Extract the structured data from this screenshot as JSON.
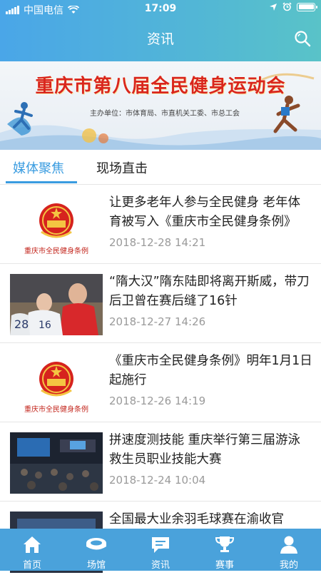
{
  "status_bar": {
    "carrier": "中国电信",
    "time": "17:09"
  },
  "header": {
    "title": "资讯"
  },
  "banner": {
    "title": "重庆市第八届全民健身运动会",
    "subtitle": "主办单位：市体育局、市直机关工委、市总工会"
  },
  "tabs": [
    {
      "label": "媒体聚焦",
      "active": true
    },
    {
      "label": "现场直击",
      "active": false
    }
  ],
  "news": [
    {
      "title": "让更多老年人参与全民健身 老年体育被写入《重庆市全民健身条例》",
      "time": "2018-12-28 14:21",
      "thumb_caption": "重庆市全民健身条例",
      "thumb": "national-emblem"
    },
    {
      "title": "“隋大汉”隋东陆即将离开斯威，带刀后卫曾在赛后缝了16针",
      "time": "2018-12-27 14:26",
      "thumb_caption": "",
      "thumb": "football-photo"
    },
    {
      "title": "《重庆市全民健身条例》明年1月1日起施行",
      "time": "2018-12-26 14:19",
      "thumb_caption": "重庆市全民健身条例",
      "thumb": "national-emblem"
    },
    {
      "title": "拼速度测技能 重庆举行第三届游泳救生员职业技能大赛",
      "time": "2018-12-24 10:04",
      "thumb_caption": "",
      "thumb": "conference-photo"
    },
    {
      "title": "全国最大业余羽毛球赛在渝收官",
      "time": "",
      "thumb_caption": "",
      "thumb": "conference-photo"
    }
  ],
  "bottom_nav": [
    {
      "label": "首页",
      "icon": "home-icon"
    },
    {
      "label": "场馆",
      "icon": "stadium-icon"
    },
    {
      "label": "资讯",
      "icon": "news-icon"
    },
    {
      "label": "赛事",
      "icon": "trophy-icon"
    },
    {
      "label": "我的",
      "icon": "user-icon"
    }
  ],
  "colors": {
    "accent": "#3a9ce0",
    "nav_bg": "#4aa2db",
    "time_gray": "#9a9a9a"
  }
}
